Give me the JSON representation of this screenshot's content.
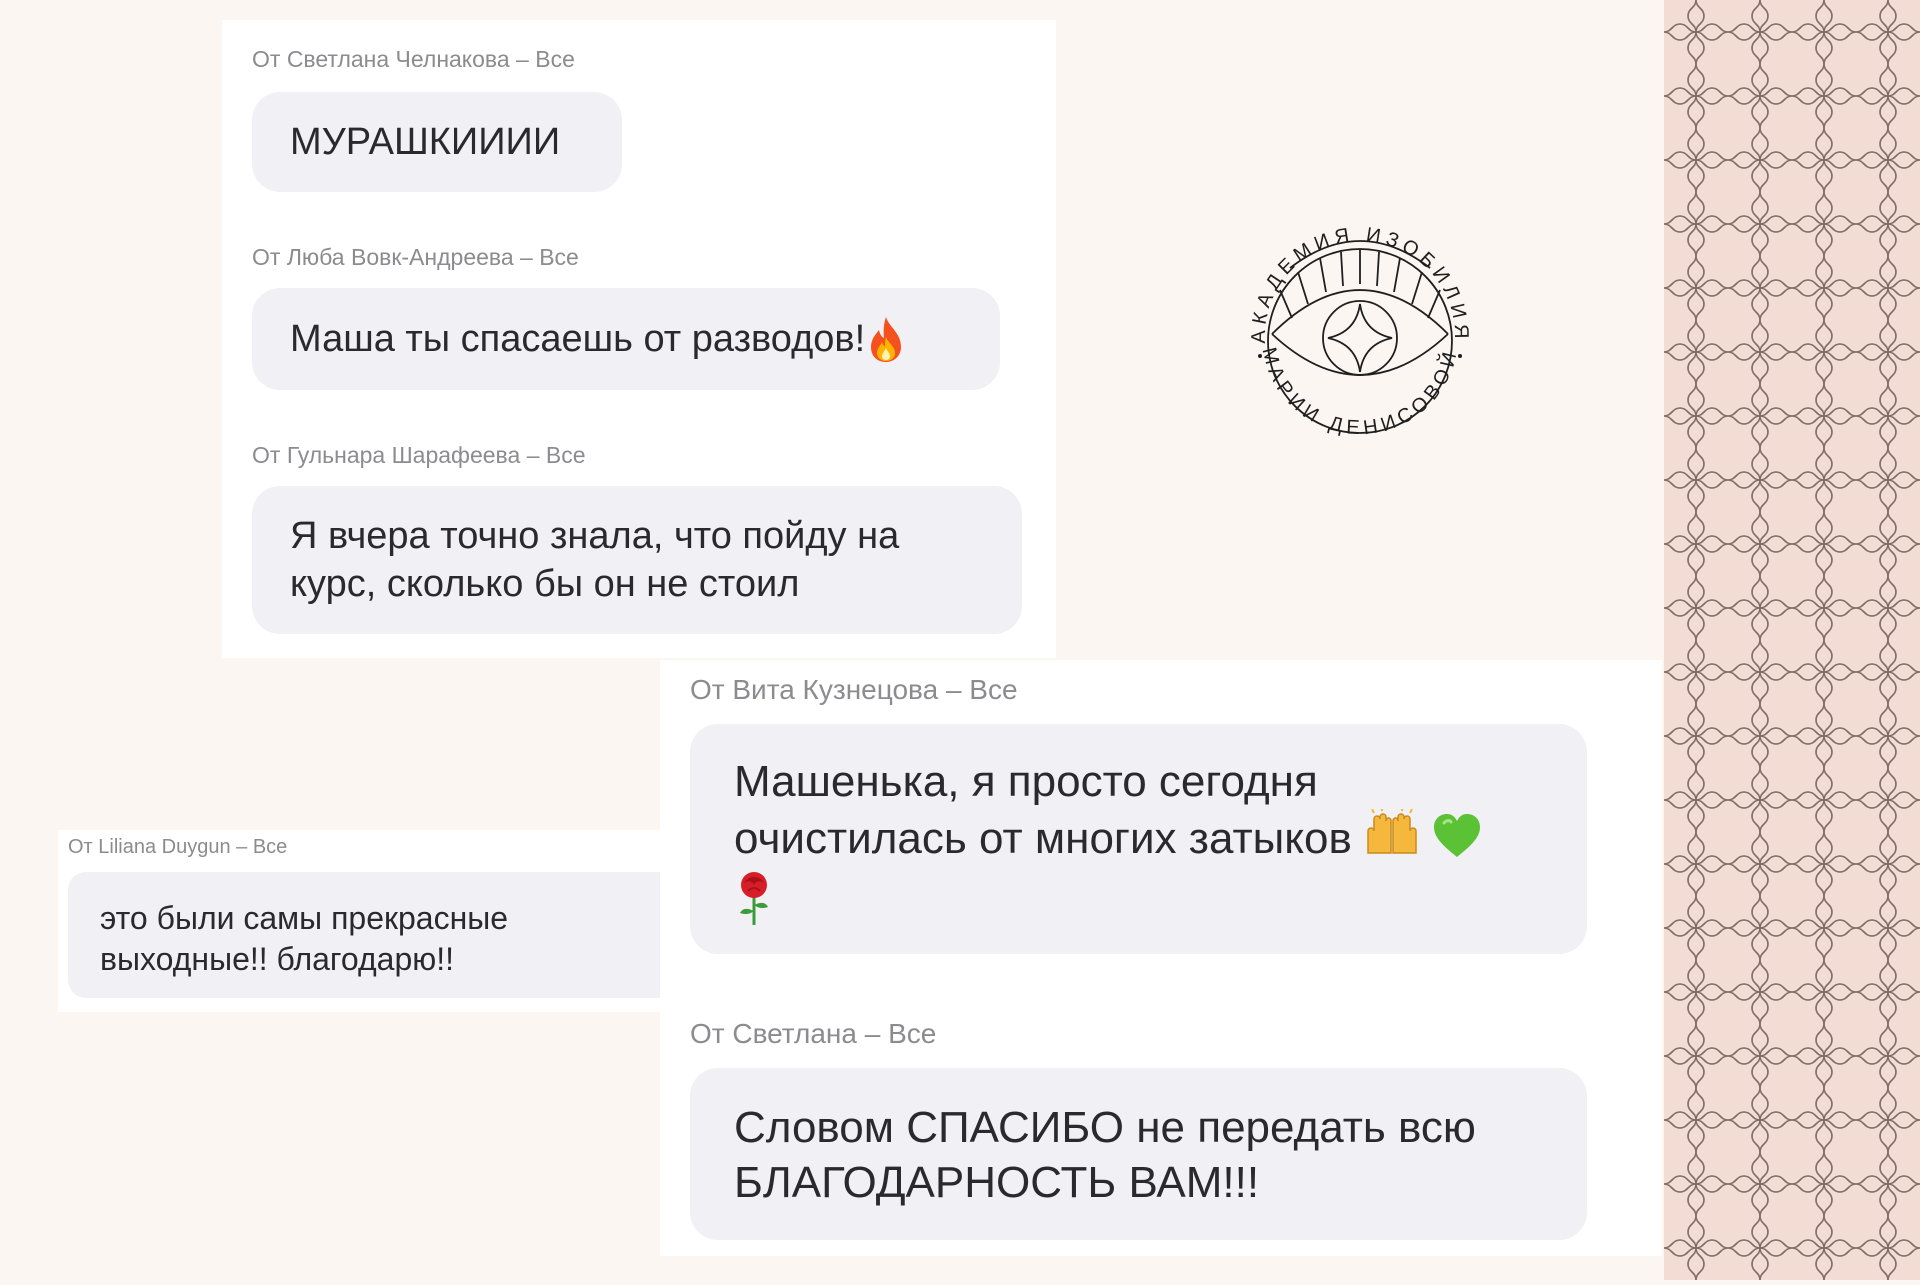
{
  "card_top": {
    "messages": [
      {
        "from": "От Светлана Челнакова – Все",
        "text": "МУРАШКИИИИ"
      },
      {
        "from": "От Люба Вовк-Андреева – Все",
        "text": "Маша ты спасаешь от разводов!",
        "emoji": "fire-emoji"
      },
      {
        "from": "От Гульнара Шарафеева – Все",
        "text": "Я вчера точно знала, что пойду на\nкурс, сколько бы он не стоил"
      }
    ]
  },
  "card_left": {
    "message": {
      "from": "От Liliana Duygun – Все",
      "text": "это были самы прекрасные\nвыходные!! благодарю!!"
    }
  },
  "card_right": {
    "messages": [
      {
        "from": "От Вита Кузнецова – Все",
        "text": "Машенька, я просто сегодня\nочистилась от многих затыков",
        "emojis": [
          "raised-hands-emoji",
          "green-heart-emoji",
          "rose-emoji"
        ]
      },
      {
        "from": "От Светлана – Все",
        "text": "Словом СПАСИБО не передать всю\nБЛАГОДАРНОСТЬ ВАМ!!!"
      }
    ]
  },
  "logo": {
    "top_text": "АКАДЕМИЯ ИЗОБИЛИЯ",
    "bottom_text": "МАРИИ ДЕНИСОВОЙ",
    "icon": "eye-icon"
  },
  "colors": {
    "background": "#fcf6f3",
    "card": "#ffffff",
    "bubble": "#f0f0f5",
    "text": "#2a2a2e",
    "meta": "#8b8b90",
    "pattern_bg": "#f2dcd4",
    "pattern_line": "#7b6a66"
  }
}
